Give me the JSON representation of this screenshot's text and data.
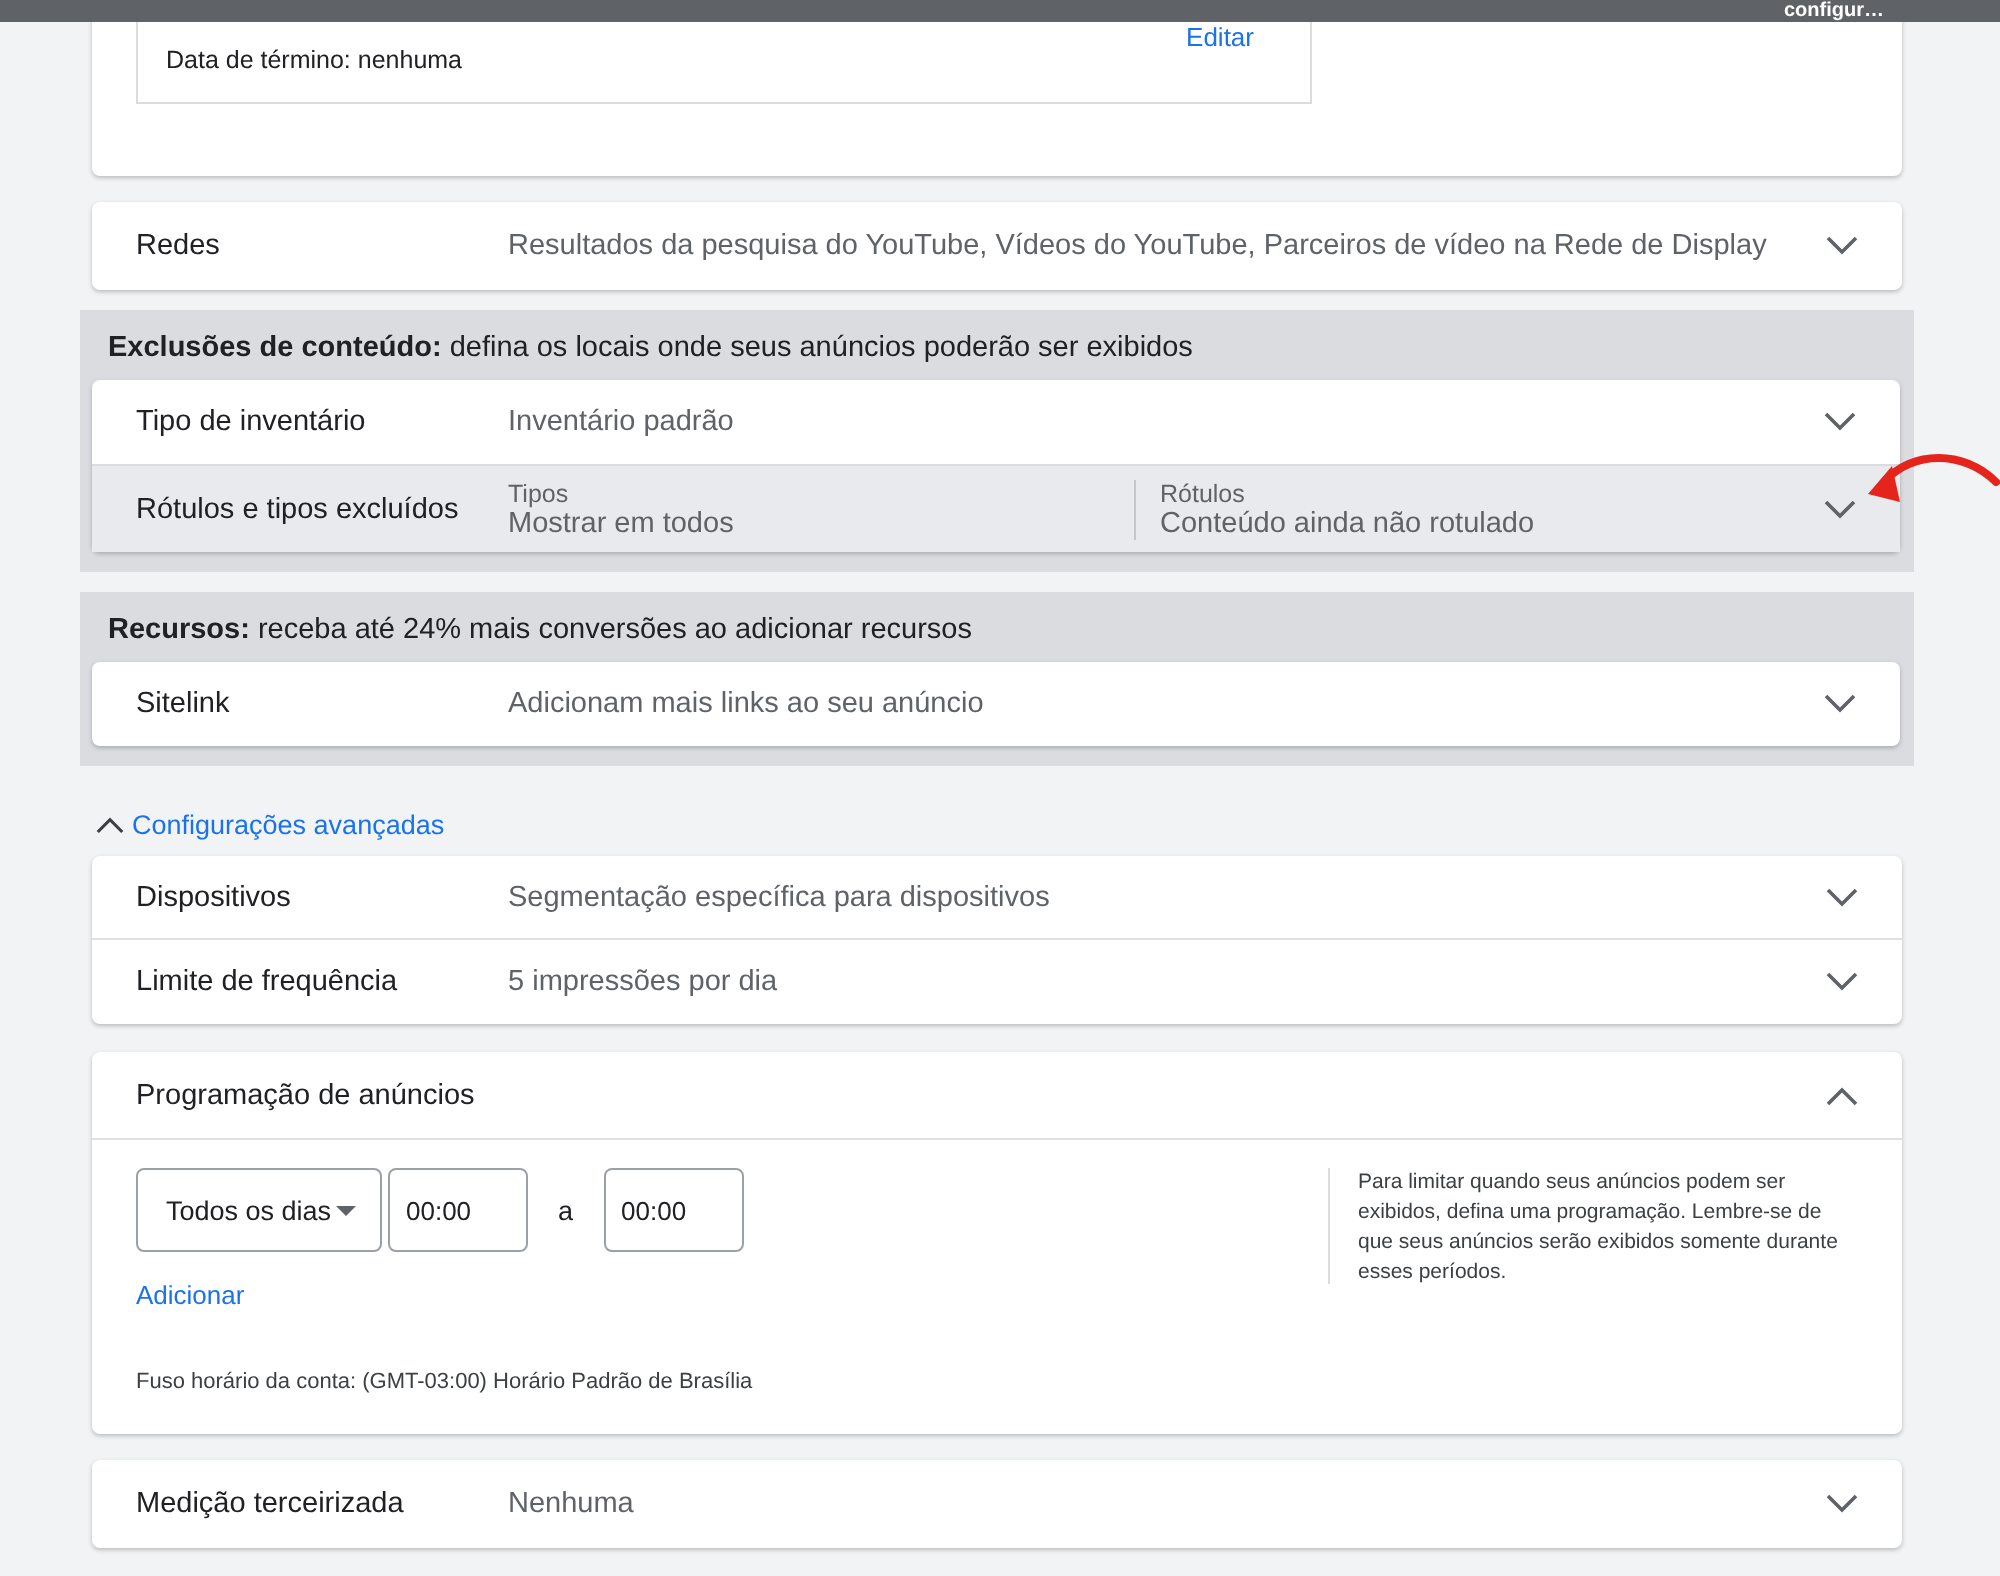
{
  "top_bar": {
    "text": "configur…"
  },
  "date_card": {
    "end_date": "Data de término: nenhuma",
    "edit_link": "Editar"
  },
  "networks": {
    "label": "Redes",
    "value": "Resultados da pesquisa do YouTube, Vídeos do YouTube, Parceiros de vídeo na Rede de Display",
    "expanded": false
  },
  "content_exclusions": {
    "heading": "**Exclusões de conteúdo:** defina os locais onde seus anúncios poderão ser exibidos",
    "rows": [
      {
        "kind": "simple",
        "label": "Tipo de inventário",
        "value": "Inventário padrão",
        "expanded": false
      },
      {
        "kind": "split",
        "label": "Rótulos e tipos excluídos",
        "columns": [
          {
            "title": "Tipos",
            "value": "Mostrar em todos"
          },
          {
            "title": "Rótulos",
            "value": "Conteúdo ainda não rotulado"
          }
        ],
        "expanded": false
      }
    ]
  },
  "resources": {
    "heading": "**Recursos:** receba até 24% mais conversões ao adicionar recursos",
    "rows": [
      {
        "kind": "simple",
        "label": "Sitelink",
        "value": "Adicionam mais links ao seu anúncio",
        "expanded": false
      }
    ]
  },
  "advanced_toggle": {
    "label": "Configurações avançadas",
    "expanded": true
  },
  "advanced_rows": [
    {
      "label": "Dispositivos",
      "value": "Segmentação específica para dispositivos",
      "expanded": false
    },
    {
      "label": "Limite de frequência",
      "value": "5 impressões por dia",
      "expanded": false
    }
  ],
  "schedule": {
    "title": "Programação de anúncios",
    "expanded": true,
    "day_select": "Todos os dias",
    "start": "00:00",
    "separator": "a",
    "end": "00:00",
    "add_link": "Adicionar",
    "timezone": "Fuso horário da conta: (GMT-03:00) Horário Padrão de Brasília",
    "help": "Para limitar quando seus anúncios podem ser exibidos, defina uma programação. Lembre-se de que seus anúncios serão exibidos somente durante esses períodos."
  },
  "third_party": {
    "label": "Medição terceirizada",
    "value": "Nenhuma",
    "expanded": false
  }
}
